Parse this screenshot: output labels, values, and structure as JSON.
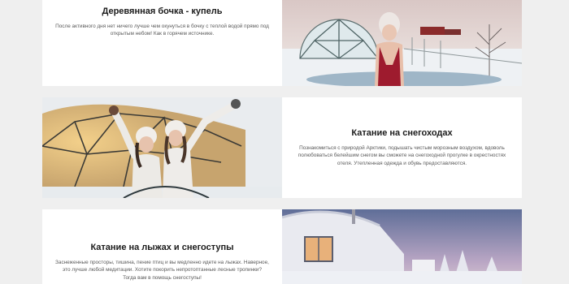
{
  "sections": [
    {
      "title": "Деревянная бочка - купель",
      "description": "После активного дня нет ничего лучше чем окунуться в бочку с теплой водой прямо под открытым небом! Как в горячем источнике.",
      "image_subject": "woman-in-red-dress-in-hot-tub"
    },
    {
      "title": "Катание на снегоходах",
      "description": "Познакомиться с природой Арктики, подышать чистым морозным воздухом, вдоволь полюбоваться белейшим снегом вы сможете на снегоходной прогулке в окрестностях отеля. Утепленная одежда и обувь предоставляются.",
      "image_subject": "two-women-in-snowsuits-near-glass-dome"
    },
    {
      "title": "Катание на лыжах и снегоступы",
      "description": "Заснеженные просторы, тишина, пение птиц и вы медленно идете на лыжах. Наверное, это лучше любой медитации. Хотите покорить непротоптанные лесные тропинки? Тогда вам в помощь снегоступы!",
      "image_subject": "snow-covered-glamping-dome-at-dusk"
    }
  ]
}
